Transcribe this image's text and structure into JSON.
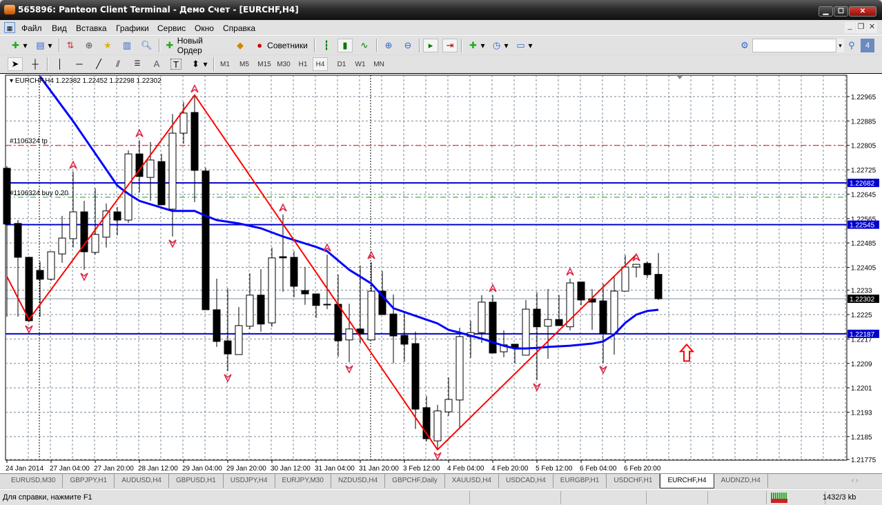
{
  "window": {
    "title": "565896: Panteon Client Terminal - Демо Счет - [EURCHF,H4]"
  },
  "menu": [
    "Файл",
    "Вид",
    "Вставка",
    "Графики",
    "Сервис",
    "Окно",
    "Справка"
  ],
  "toolbar": {
    "new_order": "Новый Ордер",
    "experts": "Советники",
    "search_placeholder": "",
    "chat_badge": "4"
  },
  "timeframes": [
    "M1",
    "M5",
    "M15",
    "M30",
    "H1",
    "H4",
    "D1",
    "W1",
    "MN"
  ],
  "active_timeframe": "H4",
  "chart": {
    "header": "EURCHF,H4  1.22382 1.22452 1.22298 1.22302",
    "symbol": "EURCHF",
    "period": "H4",
    "price_ticks": [
      1.22965,
      1.22885,
      1.22805,
      1.22725,
      1.22645,
      1.22565,
      1.22485,
      1.22405,
      1.2233,
      1.2225,
      1.2217,
      1.2209,
      1.2201,
      1.2193,
      1.2185,
      1.21775
    ],
    "time_ticks": [
      {
        "i": 0,
        "label": "24 Jan 2014"
      },
      {
        "i": 4,
        "label": "27 Jan 04:00"
      },
      {
        "i": 8,
        "label": "27 Jan 20:00"
      },
      {
        "i": 12,
        "label": "28 Jan 12:00"
      },
      {
        "i": 16,
        "label": "29 Jan 04:00"
      },
      {
        "i": 20,
        "label": "29 Jan 20:00"
      },
      {
        "i": 24,
        "label": "30 Jan 12:00"
      },
      {
        "i": 28,
        "label": "31 Jan 04:00"
      },
      {
        "i": 32,
        "label": "31 Jan 20:00"
      },
      {
        "i": 36,
        "label": "3 Feb 12:00"
      },
      {
        "i": 40,
        "label": "4 Feb 04:00"
      },
      {
        "i": 44,
        "label": "4 Feb 20:00"
      },
      {
        "i": 48,
        "label": "5 Feb 12:00"
      },
      {
        "i": 52,
        "label": "6 Feb 04:00"
      },
      {
        "i": 56,
        "label": "6 Feb 20:00"
      }
    ],
    "candles_ohlc": [
      [
        1.2273,
        1.22737,
        1.22243,
        1.22547
      ],
      [
        1.22549,
        1.2256,
        1.22243,
        1.22438
      ],
      [
        1.22438,
        1.2244,
        1.22225,
        1.2223
      ],
      [
        1.22395,
        1.22424,
        1.22243,
        1.22366
      ],
      [
        1.22366,
        1.22456,
        1.22361,
        1.22456
      ],
      [
        1.22449,
        1.22574,
        1.2242,
        1.22501
      ],
      [
        1.22499,
        1.22718,
        1.2247,
        1.22587
      ],
      [
        1.22587,
        1.22623,
        1.22397,
        1.22456
      ],
      [
        1.22454,
        1.22664,
        1.22447,
        1.22513
      ],
      [
        1.22504,
        1.22614,
        1.2247,
        1.2259
      ],
      [
        1.22587,
        1.22603,
        1.2251,
        1.2256
      ],
      [
        1.2256,
        1.22789,
        1.22551,
        1.22777
      ],
      [
        1.22777,
        1.22822,
        1.22651,
        1.22703
      ],
      [
        1.227,
        1.22816,
        1.22623,
        1.22757
      ],
      [
        1.22752,
        1.22777,
        1.2261,
        1.2261
      ],
      [
        1.22596,
        1.22908,
        1.22506,
        1.22845
      ],
      [
        1.22845,
        1.22947,
        1.22811,
        1.22911
      ],
      [
        1.22913,
        1.22968,
        1.22619,
        1.22723
      ],
      [
        1.22721,
        1.22732,
        1.22266,
        1.22266
      ],
      [
        1.22266,
        1.22368,
        1.22144,
        1.22162
      ],
      [
        1.22164,
        1.22336,
        1.22065,
        1.22121
      ],
      [
        1.22119,
        1.22275,
        1.22119,
        1.22214
      ],
      [
        1.22212,
        1.22386,
        1.22203,
        1.22314
      ],
      [
        1.22314,
        1.22399,
        1.22194,
        1.22219
      ],
      [
        1.22223,
        1.2247,
        1.2221,
        1.22436
      ],
      [
        1.2244,
        1.22578,
        1.22325,
        1.22436
      ],
      [
        1.22438,
        1.22458,
        1.22307,
        1.22343
      ],
      [
        1.22329,
        1.22406,
        1.22282,
        1.22318
      ],
      [
        1.22318,
        1.22318,
        1.22239,
        1.2228
      ],
      [
        1.22284,
        1.22447,
        1.22268,
        1.22282
      ],
      [
        1.22284,
        1.22381,
        1.22112,
        1.22164
      ],
      [
        1.22167,
        1.22286,
        1.22094,
        1.22203
      ],
      [
        1.22203,
        1.22411,
        1.22155,
        1.22187
      ],
      [
        1.22167,
        1.22422,
        1.22167,
        1.22327
      ],
      [
        1.22327,
        1.22393,
        1.2225,
        1.2225
      ],
      [
        1.22252,
        1.22316,
        1.2209,
        1.2218
      ],
      [
        1.22182,
        1.22255,
        1.22096,
        1.22153
      ],
      [
        1.22155,
        1.22194,
        1.21875,
        1.2194
      ],
      [
        1.21945,
        1.21983,
        1.21834,
        1.21843
      ],
      [
        1.21836,
        1.21954,
        1.21809,
        1.21934
      ],
      [
        1.21931,
        1.22044,
        1.21918,
        1.21972
      ],
      [
        1.2197,
        1.22207,
        1.21877,
        1.22178
      ],
      [
        1.22178,
        1.2223,
        1.22108,
        1.22191
      ],
      [
        1.22191,
        1.22314,
        1.22157,
        1.22291
      ],
      [
        1.22291,
        1.22314,
        1.22124,
        1.22124
      ],
      [
        1.22128,
        1.22198,
        1.2211,
        1.22151
      ],
      [
        1.22153,
        1.22153,
        1.2209,
        1.22142
      ],
      [
        1.22117,
        1.22298,
        1.22117,
        1.22268
      ],
      [
        1.22268,
        1.22323,
        1.22035,
        1.2221
      ],
      [
        1.22212,
        1.22334,
        1.22105,
        1.22234
      ],
      [
        1.22234,
        1.22314,
        1.22214,
        1.22214
      ],
      [
        1.2221,
        1.22368,
        1.22198,
        1.22354
      ],
      [
        1.22357,
        1.22357,
        1.2228,
        1.22298
      ],
      [
        1.22302,
        1.22334,
        1.222,
        1.22291
      ],
      [
        1.22295,
        1.22352,
        1.22092,
        1.22187
      ],
      [
        1.22187,
        1.22375,
        1.22119,
        1.22327
      ],
      [
        1.22327,
        1.22445,
        1.22327,
        1.22406
      ],
      [
        1.22406,
        1.22415,
        1.22372,
        1.22415
      ],
      [
        1.22418,
        1.22424,
        1.2237,
        1.22381
      ],
      [
        1.22382,
        1.22452,
        1.22298,
        1.22302
      ]
    ],
    "ma_points": [
      [
        3,
        1.23031
      ],
      [
        6,
        1.22884
      ],
      [
        10,
        1.22673
      ],
      [
        11,
        1.22646
      ],
      [
        12,
        1.22623
      ],
      [
        15,
        1.2259
      ],
      [
        17,
        1.2259
      ],
      [
        18,
        1.22574
      ],
      [
        19,
        1.2256
      ],
      [
        21,
        1.22549
      ],
      [
        23,
        1.22533
      ],
      [
        25,
        1.22506
      ],
      [
        28,
        1.22472
      ],
      [
        29,
        1.22458
      ],
      [
        31,
        1.22397
      ],
      [
        33,
        1.22352
      ],
      [
        35,
        1.22271
      ],
      [
        37,
        1.22246
      ],
      [
        39,
        1.22221
      ],
      [
        40,
        1.222
      ],
      [
        41,
        1.22191
      ],
      [
        43,
        1.22171
      ],
      [
        45,
        1.22148
      ],
      [
        46,
        1.22139
      ],
      [
        47,
        1.22139
      ],
      [
        48,
        1.22141
      ],
      [
        49,
        1.22144
      ],
      [
        51,
        1.22148
      ],
      [
        53,
        1.22155
      ],
      [
        54,
        1.22162
      ],
      [
        55,
        1.22185
      ],
      [
        56,
        1.22223
      ],
      [
        57,
        1.2225
      ],
      [
        58,
        1.22262
      ],
      [
        59,
        1.22266
      ]
    ],
    "zigzag_points": [
      [
        0,
        1.22375
      ],
      [
        2,
        1.22234
      ],
      [
        17,
        1.2297
      ],
      [
        39,
        1.21807
      ],
      [
        57,
        1.22447
      ]
    ],
    "fractals_up": [
      6,
      12,
      17,
      25,
      29,
      33,
      44,
      51,
      57
    ],
    "fractals_down": [
      2,
      7,
      15,
      20,
      31,
      39,
      48,
      54
    ],
    "levels": [
      {
        "price": 1.22682,
        "label": "1.22682",
        "color": "#0000cc"
      },
      {
        "price": 1.22545,
        "label": "1.22545",
        "color": "#0000cc"
      },
      {
        "price": 1.22187,
        "label": "1.22187",
        "color": "#0000cc"
      }
    ],
    "current_price": {
      "price": 1.22302,
      "label": "1.22302"
    },
    "orders": [
      {
        "price": 1.22805,
        "label": "#1106324 tp",
        "color": "#ff0000"
      },
      {
        "price": 1.22635,
        "label": "#1106324 buy 0.20",
        "color": "#00b000"
      }
    ],
    "signal_arrow": {
      "i": 61,
      "price": 1.2217,
      "direction": "up",
      "color": "#ff0000"
    },
    "colors": {
      "ma": "#0000ff",
      "zigzag": "#ff0000",
      "fractal": "#dd2244",
      "grid": "#778899"
    }
  },
  "tabs": [
    "EURUSD,M30",
    "GBPJPY,H1",
    "AUDUSD,H4",
    "GBPUSD,H1",
    "USDJPY,H4",
    "EURJPY,M30",
    "NZDUSD,H4",
    "GBPCHF,Daily",
    "XAUUSD,H4",
    "USDCAD,H4",
    "EURGBP,H1",
    "USDCHF,H1",
    "EURCHF,H4",
    "AUDNZD,H4"
  ],
  "active_tab": "EURCHF,H4",
  "status": {
    "help": "Для справки, нажмите F1",
    "traffic": "1432/3 kb"
  }
}
